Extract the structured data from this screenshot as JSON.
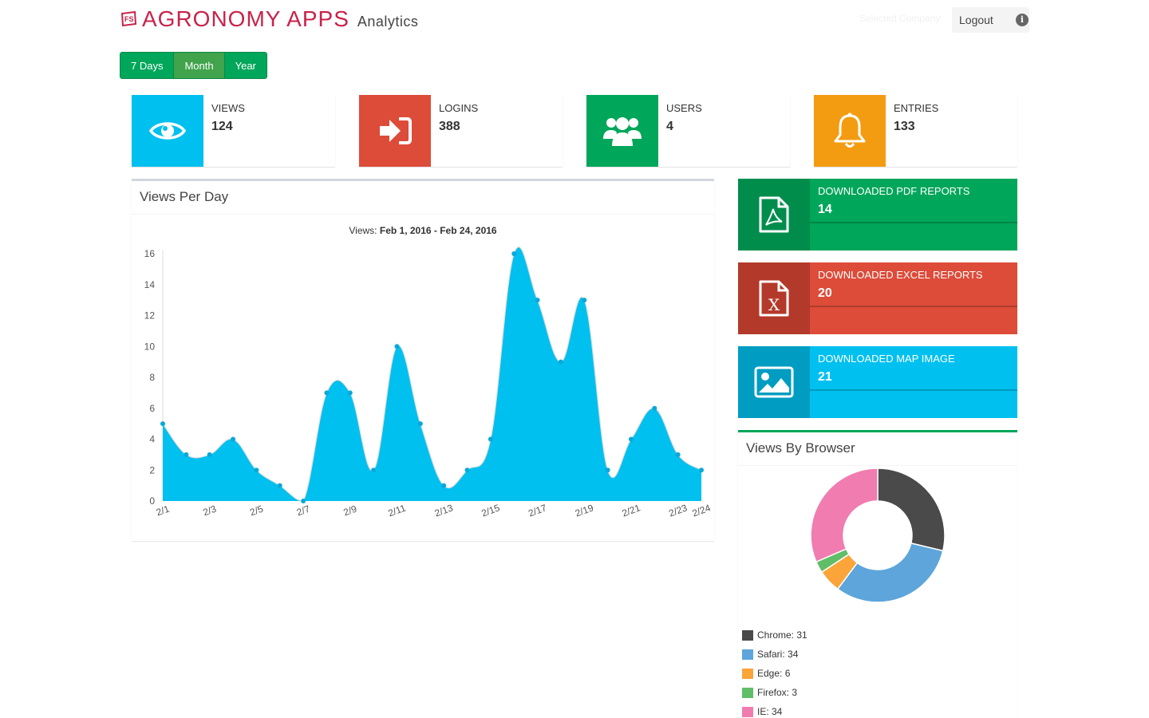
{
  "header": {
    "logo_text": "FS",
    "brand": "AGRONOMY APPS",
    "subtitle": "Analytics",
    "company_label": "Selected Company:",
    "logout_label": "Logout"
  },
  "range_buttons": [
    {
      "label": "7 Days",
      "active": false
    },
    {
      "label": "Month",
      "active": true
    },
    {
      "label": "Year",
      "active": false
    }
  ],
  "stats": [
    {
      "label": "VIEWS",
      "value": "124",
      "color": "#00c0ef",
      "icon": "eye-icon"
    },
    {
      "label": "LOGINS",
      "value": "388",
      "color": "#dd4b39",
      "icon": "sign-in-icon"
    },
    {
      "label": "USERS",
      "value": "4",
      "color": "#00a65a",
      "icon": "users-icon"
    },
    {
      "label": "ENTRIES",
      "value": "133",
      "color": "#f39c12",
      "icon": "bell-icon"
    }
  ],
  "downloads": [
    {
      "label": "DOWNLOADED PDF REPORTS",
      "value": "14",
      "color": "#00a65a",
      "icon_bg": "#008d4c",
      "icon": "pdf-file-icon"
    },
    {
      "label": "DOWNLOADED EXCEL REPORTS",
      "value": "20",
      "color": "#dd4b39",
      "icon_bg": "#b33a2b",
      "icon": "excel-file-icon"
    },
    {
      "label": "DOWNLOADED MAP IMAGE",
      "value": "21",
      "color": "#00c0ef",
      "icon_bg": "#009cc2",
      "icon": "image-icon"
    }
  ],
  "views_box": {
    "title": "Views Per Day",
    "chart_prefix": "Views: ",
    "chart_range": "Feb 1, 2016 - Feb 24, 2016"
  },
  "browser_box": {
    "title": "Views By Browser"
  },
  "chart_data": [
    {
      "type": "area",
      "title": "Views: Feb 1, 2016 - Feb 24, 2016",
      "x": [
        "2/1",
        "2/2",
        "2/3",
        "2/4",
        "2/5",
        "2/6",
        "2/7",
        "2/8",
        "2/9",
        "2/10",
        "2/11",
        "2/12",
        "2/13",
        "2/14",
        "2/15",
        "2/16",
        "2/17",
        "2/18",
        "2/19",
        "2/20",
        "2/21",
        "2/22",
        "2/23",
        "2/24"
      ],
      "values": [
        5,
        3,
        3,
        4,
        2,
        1,
        0,
        7,
        7,
        2,
        10,
        5,
        1,
        2,
        4,
        16,
        13,
        9,
        13,
        2,
        4,
        6,
        3,
        2
      ],
      "x_tick_labels": [
        "2/1",
        "2/3",
        "2/5",
        "2/7",
        "2/9",
        "2/11",
        "2/13",
        "2/15",
        "2/17",
        "2/19",
        "2/21",
        "2/23",
        "2/24"
      ],
      "y_ticks": [
        0,
        2,
        4,
        6,
        8,
        10,
        12,
        14,
        16
      ],
      "ylim": [
        0,
        16
      ],
      "color": "#00c0ef",
      "grid": false
    },
    {
      "type": "pie",
      "title": "Views By Browser",
      "donut": true,
      "slices": [
        {
          "name": "Chrome",
          "value": 31,
          "color": "#4a4a4a",
          "label": "Chrome: 31"
        },
        {
          "name": "Safari",
          "value": 34,
          "color": "#5da5da",
          "label": "Safari: 34"
        },
        {
          "name": "Edge",
          "value": 6,
          "color": "#faa43a",
          "label": "Edge: 6"
        },
        {
          "name": "Firefox",
          "value": 3,
          "color": "#60bd68",
          "label": "Firefox: 3"
        },
        {
          "name": "IE",
          "value": 34,
          "color": "#f17cb0",
          "label": "IE: 34"
        }
      ]
    }
  ]
}
